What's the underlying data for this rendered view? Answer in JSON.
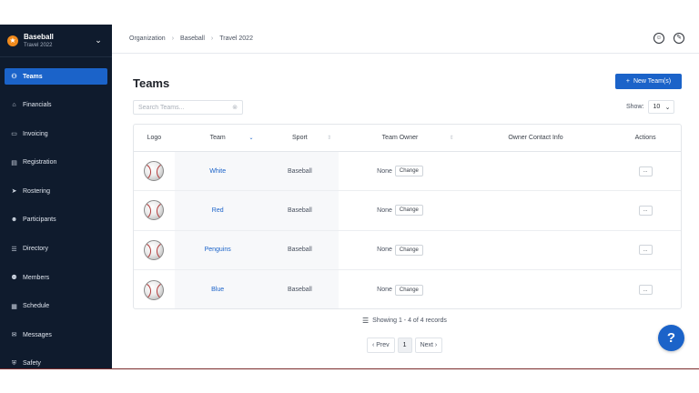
{
  "org": {
    "name": "Baseball",
    "subtitle": "Travel 2022"
  },
  "sidebar": {
    "items": [
      {
        "label": "Teams",
        "icon": "teams-icon",
        "active": true
      },
      {
        "label": "Financials",
        "icon": "bank-icon"
      },
      {
        "label": "Invoicing",
        "icon": "invoice-icon"
      },
      {
        "label": "Registration",
        "icon": "registration-icon"
      },
      {
        "label": "Rostering",
        "icon": "cursor-icon"
      },
      {
        "label": "Participants",
        "icon": "participants-icon"
      },
      {
        "label": "Directory",
        "icon": "directory-icon"
      },
      {
        "label": "Members",
        "icon": "members-icon"
      },
      {
        "label": "Schedule",
        "icon": "calendar-icon"
      },
      {
        "label": "Messages",
        "icon": "message-icon"
      },
      {
        "label": "Safety",
        "icon": "shield-icon"
      }
    ]
  },
  "breadcrumb": [
    "Organization",
    "Baseball",
    "Travel 2022"
  ],
  "page": {
    "title": "Teams",
    "new_button": "New Team(s)",
    "search_placeholder": "Search Teams...",
    "show_label": "Show:",
    "show_value": "10"
  },
  "table": {
    "headers": [
      "Logo",
      "Team",
      "Sport",
      "Team Owner",
      "Owner Contact Info",
      "Actions"
    ],
    "rows": [
      {
        "team": "White",
        "sport": "Baseball",
        "owner": "None",
        "change": "Change",
        "contact": "",
        "action": "..."
      },
      {
        "team": "Red",
        "sport": "Baseball",
        "owner": "None",
        "change": "Change",
        "contact": "",
        "action": "..."
      },
      {
        "team": "Penguins",
        "sport": "Baseball",
        "owner": "None",
        "change": "Change",
        "contact": "",
        "action": "..."
      },
      {
        "team": "Blue",
        "sport": "Baseball",
        "owner": "None",
        "change": "Change",
        "contact": "",
        "action": "..."
      }
    ]
  },
  "footer": {
    "records": "Showing 1 - 4 of 4 records",
    "prev": "‹ Prev",
    "page": "1",
    "next": "Next ›"
  },
  "help_label": "?",
  "colors": {
    "sidebar": "#0f1b2d",
    "accent": "#1b63c9",
    "logo": "#f08a1c"
  }
}
